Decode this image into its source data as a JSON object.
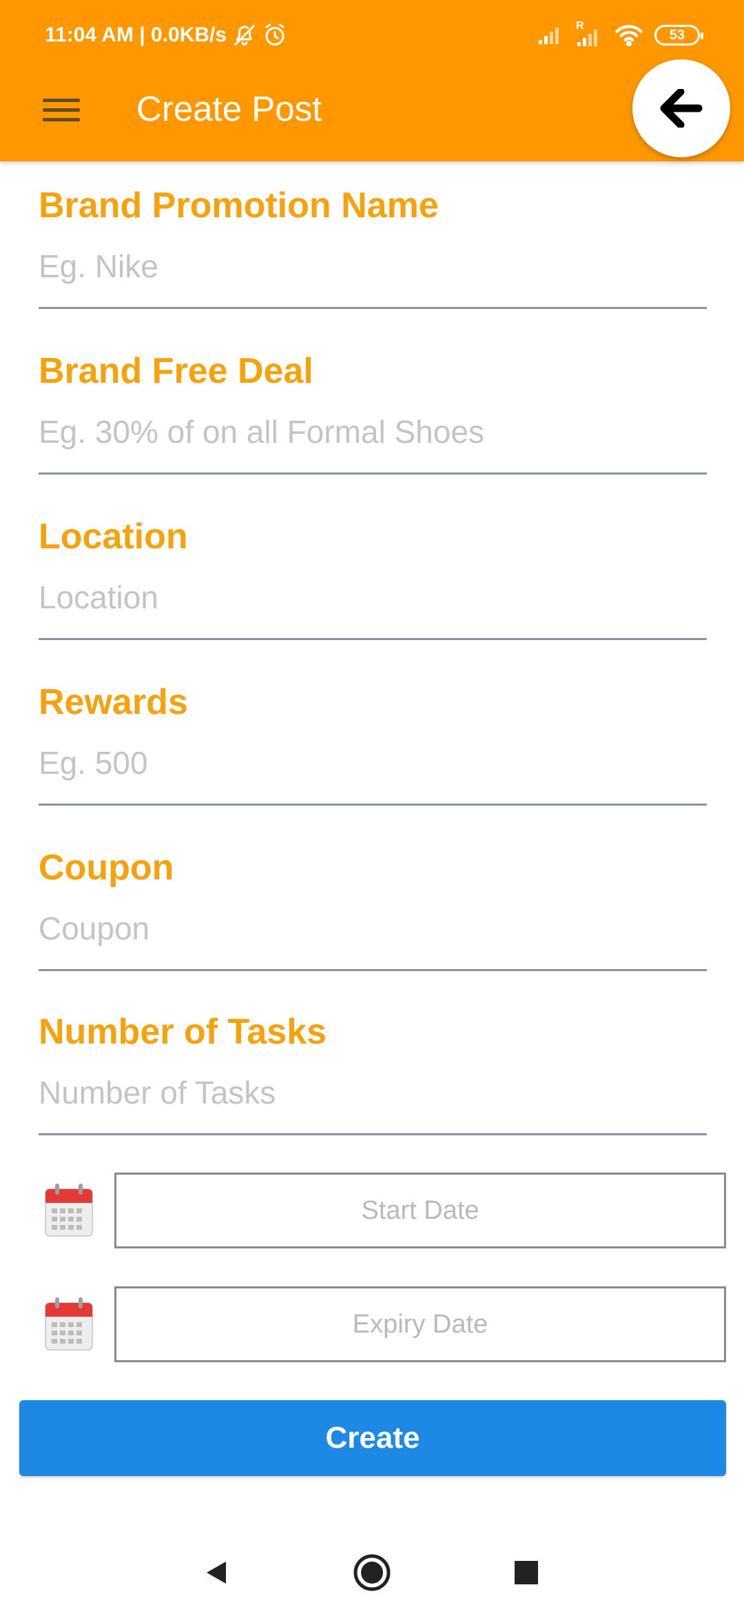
{
  "status_bar": {
    "time_info": "11:04 AM | 0.0KB/s",
    "battery": "53",
    "roaming_mark": "R",
    "icons": [
      "bell-off-icon",
      "alarm-icon",
      "signal-icon",
      "signal-roaming-icon",
      "wifi-icon",
      "battery-icon"
    ]
  },
  "app_bar": {
    "title": "Create Post",
    "menu_icon": "hamburger-menu-icon",
    "back_icon": "arrow-left-icon",
    "color": "#FF9800"
  },
  "form": {
    "fields": [
      {
        "label": "Brand Promotion Name",
        "placeholder": "Eg. Nike",
        "value": ""
      },
      {
        "label": "Brand Free Deal",
        "placeholder": "Eg. 30% of on all Formal Shoes",
        "value": ""
      },
      {
        "label": "Location",
        "placeholder": "Location",
        "value": ""
      },
      {
        "label": "Rewards",
        "placeholder": "Eg. 500",
        "value": ""
      },
      {
        "label": "Coupon",
        "placeholder": "Coupon",
        "value": ""
      },
      {
        "label": "Number of Tasks",
        "placeholder": "Number of Tasks",
        "value": ""
      }
    ],
    "label_color": "#F5A20F",
    "start_date": {
      "placeholder": "Start Date",
      "icon": "calendar-icon"
    },
    "expiry_date": {
      "placeholder": "Expiry Date",
      "icon": "calendar-icon"
    },
    "submit_label": "Create",
    "submit_color": "#1E88E5"
  },
  "nav_bar": {
    "icons": [
      "back-triangle-icon",
      "home-circle-icon",
      "recents-square-icon"
    ]
  }
}
